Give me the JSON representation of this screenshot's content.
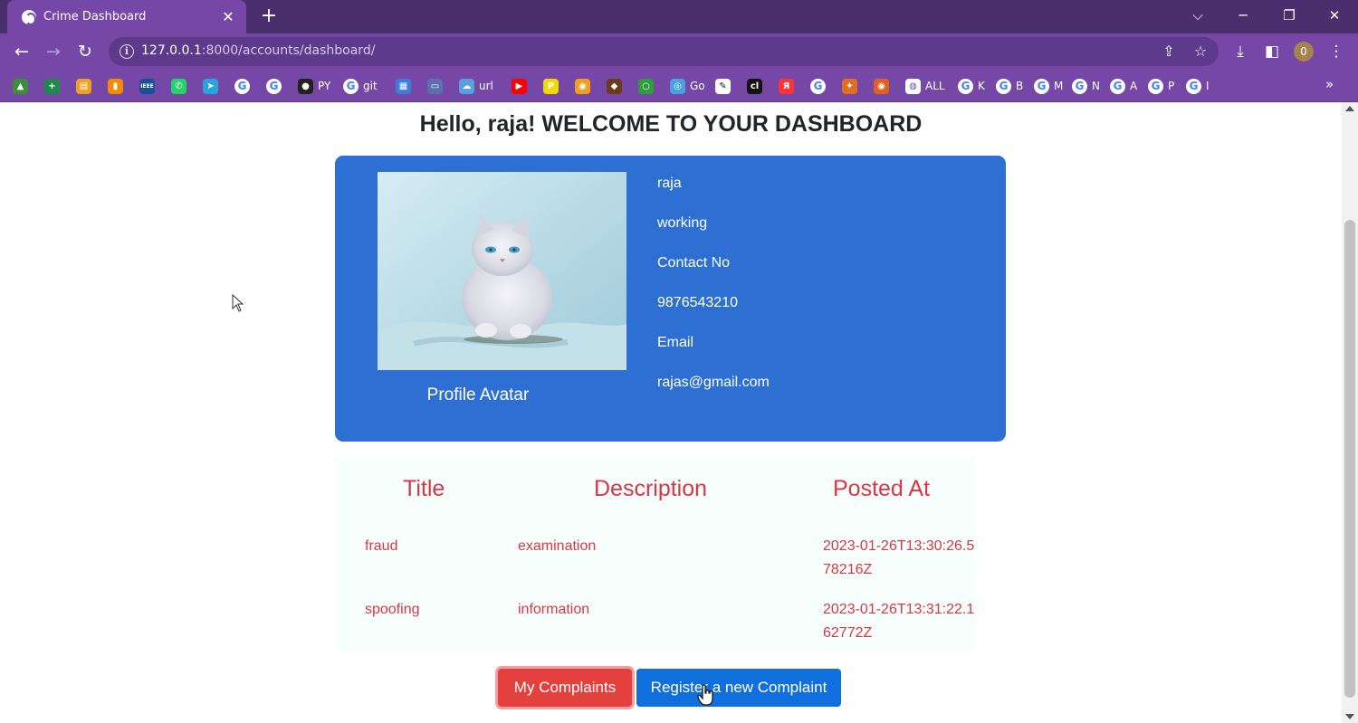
{
  "browser": {
    "tab": {
      "title": "Crime Dashboard",
      "close": "✕",
      "icon": "globe-icon"
    },
    "new_tab": "+",
    "window_controls": {
      "chevron": "⌵",
      "minimize": "─",
      "restore": "❐",
      "close": "✕"
    },
    "nav": {
      "back": "←",
      "forward": "→",
      "reload": "↻"
    },
    "url_host": "127.0.0.1",
    "url_rest": ":8000/accounts/dashboard/",
    "profile_initial": "0",
    "accent": "#7548a8",
    "bookmarks": [
      {
        "icon": "drive-icon",
        "label": "",
        "color": "#3a8f3a",
        "glyph": "▲"
      },
      {
        "icon": "plus-app-icon",
        "label": "",
        "color": "#1e8a4a",
        "glyph": "+"
      },
      {
        "icon": "slides-icon",
        "label": "",
        "color": "#f0a020",
        "glyph": "▤"
      },
      {
        "icon": "analytics-icon",
        "label": "",
        "color": "#f28b00",
        "glyph": "▮"
      },
      {
        "icon": "ieee-icon",
        "label": "",
        "color": "#1a4f9c",
        "glyph": "IEEE"
      },
      {
        "icon": "whatsapp-icon",
        "label": "",
        "color": "#25d366",
        "glyph": "✆"
      },
      {
        "icon": "telegram-icon",
        "label": "",
        "color": "#2aa3e0",
        "glyph": "➤"
      },
      {
        "icon": "google-icon",
        "label": "",
        "glyph": "G",
        "g": true
      },
      {
        "icon": "google-icon",
        "label": "",
        "glyph": "G",
        "g": true
      },
      {
        "icon": "github-icon",
        "label": "PY",
        "color": "#222222",
        "glyph": "●"
      },
      {
        "icon": "google-icon",
        "label": "git",
        "glyph": "G",
        "g": true
      },
      {
        "icon": "calendar-icon",
        "label": "",
        "color": "#3b7dd8",
        "glyph": "▦"
      },
      {
        "icon": "bus-icon",
        "label": "",
        "color": "#5a6fb0",
        "glyph": "▭"
      },
      {
        "icon": "cloud-icon",
        "label": "url",
        "color": "#5aa0e0",
        "glyph": "☁"
      },
      {
        "icon": "youtube-icon",
        "label": "",
        "color": "#ff0000",
        "glyph": "▶"
      },
      {
        "icon": "p-app-icon",
        "label": "",
        "color": "#f5d800",
        "glyph": "P"
      },
      {
        "icon": "camera-icon",
        "label": "",
        "color": "#f0a020",
        "glyph": "◉"
      },
      {
        "icon": "coin-icon",
        "label": "",
        "color": "#6b3a1a",
        "glyph": "◆"
      },
      {
        "icon": "ring-icon",
        "label": "",
        "color": "#2e9d3c",
        "glyph": "○"
      },
      {
        "icon": "go-app-icon",
        "label": "Go",
        "color": "#4aa0e0",
        "glyph": "◎"
      },
      {
        "icon": "pen-app-icon",
        "label": "",
        "color": "#ffffff",
        "glyph": "✎"
      },
      {
        "icon": "cl-app-icon",
        "label": "",
        "color": "#111111",
        "glyph": "cl"
      },
      {
        "icon": "yandex-icon",
        "label": "",
        "color": "#ff3333",
        "glyph": "Я"
      },
      {
        "icon": "google-icon",
        "label": "",
        "glyph": "G",
        "g": true
      },
      {
        "icon": "bird-icon",
        "label": "",
        "color": "#e07020",
        "glyph": "✦"
      },
      {
        "icon": "eye-icon",
        "label": "",
        "color": "#e06020",
        "glyph": "◉"
      },
      {
        "icon": "globe-icon",
        "label": "ALL",
        "color": "#ffffff",
        "glyph": "◍"
      },
      {
        "icon": "google-icon",
        "label": "K",
        "glyph": "G",
        "g": true
      },
      {
        "icon": "google-icon",
        "label": "B",
        "glyph": "G",
        "g": true
      },
      {
        "icon": "google-icon",
        "label": "M",
        "glyph": "G",
        "g": true
      },
      {
        "icon": "google-icon",
        "label": "N",
        "glyph": "G",
        "g": true
      },
      {
        "icon": "google-icon",
        "label": "A",
        "glyph": "G",
        "g": true
      },
      {
        "icon": "google-icon",
        "label": "P",
        "glyph": "G",
        "g": true
      },
      {
        "icon": "google-icon",
        "label": "I",
        "glyph": "G",
        "g": true
      }
    ],
    "bookmarks_more": "»"
  },
  "page": {
    "heading": "Hello, raja! WELCOME TO YOUR DASHBOARD",
    "profile": {
      "avatar_label": "Profile Avatar",
      "name": "raja",
      "status": "working",
      "contact_label": "Contact No",
      "contact": "9876543210",
      "email_label": "Email",
      "email": "rajas@gmail.com",
      "card_color": "#2d6fd3"
    },
    "table": {
      "headers": [
        "Title",
        "Description",
        "Posted At"
      ],
      "rows": [
        {
          "title": "fraud",
          "description": "examination",
          "posted_at": "2023-01-26T13:30:26.578216Z"
        },
        {
          "title": "spoofing",
          "description": "information",
          "posted_at": "2023-01-26T13:31:22.162772Z"
        }
      ],
      "text_color": "#dc3545"
    },
    "buttons": {
      "my_complaints": "My Complaints",
      "register": "Register a new Complaint"
    }
  }
}
